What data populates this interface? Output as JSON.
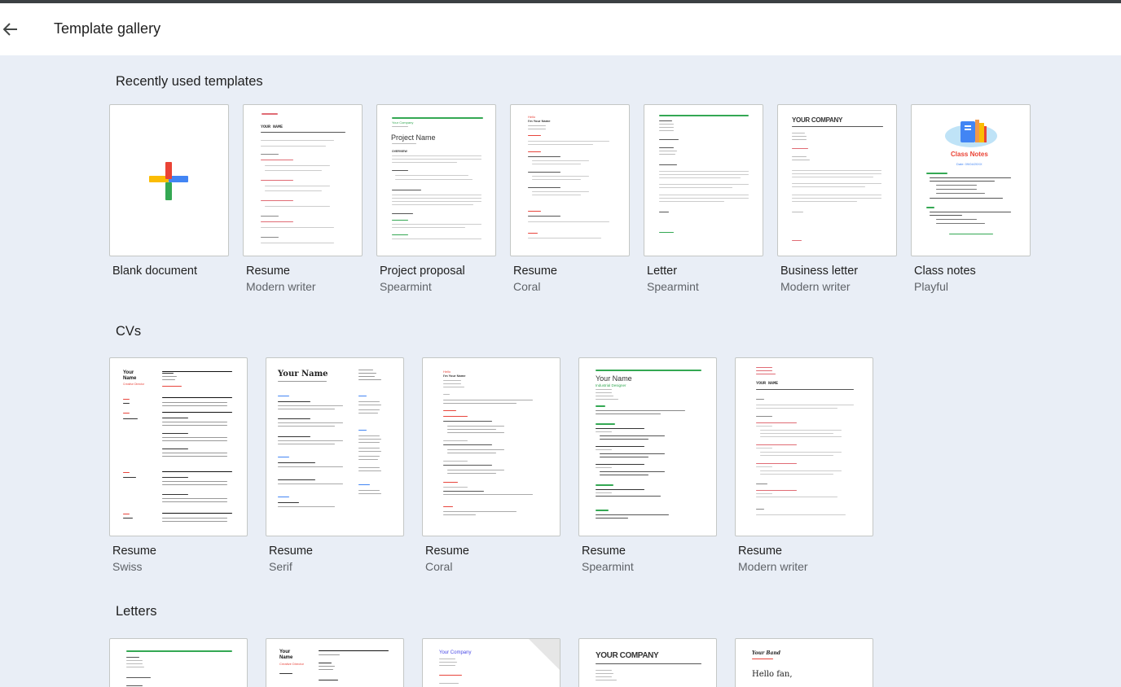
{
  "header": {
    "title": "Template gallery"
  },
  "sections": {
    "recent": "Recently used templates",
    "cvs": "CVs",
    "letters": "Letters"
  },
  "recent_templates": [
    {
      "name": "Blank document",
      "sub": ""
    },
    {
      "name": "Resume",
      "sub": "Modern writer"
    },
    {
      "name": "Project proposal",
      "sub": "Spearmint"
    },
    {
      "name": "Resume",
      "sub": "Coral"
    },
    {
      "name": "Letter",
      "sub": "Spearmint"
    },
    {
      "name": "Business letter",
      "sub": "Modern writer"
    },
    {
      "name": "Class notes",
      "sub": "Playful"
    }
  ],
  "cv_templates": [
    {
      "name": "Resume",
      "sub": "Swiss"
    },
    {
      "name": "Resume",
      "sub": "Serif"
    },
    {
      "name": "Resume",
      "sub": "Coral"
    },
    {
      "name": "Resume",
      "sub": "Spearmint"
    },
    {
      "name": "Resume",
      "sub": "Modern writer"
    }
  ],
  "thumb_text": {
    "modern_writer_name": "YOUR NAME",
    "proposal_company": "Your Company",
    "proposal_title": "Project Name",
    "proposal_overview": "OVERVIEW",
    "coral_hello": "Hello",
    "coral_name": "I'm Your Name",
    "business_company": "YOUR COMPANY",
    "classnotes_title": "Class Notes",
    "classnotes_date": "Date: 09/04/20XX",
    "swiss_name": "Your Name",
    "swiss_role": "Creative Director",
    "serif_name": "Your Name",
    "spearmint_name": "Your Name",
    "spearmint_role": "Industrial Designer",
    "mw_cv_name": "YOUR NAME",
    "letter_swiss_name": "Your Name",
    "letter_swiss_role": "Creative Director",
    "letter_company": "Your Company",
    "letter_your_company": "YOUR COMPANY",
    "letter_signature": "Your Band",
    "letter_hello": "Hello fan,"
  },
  "colors": {
    "accent_green": "#34a853",
    "accent_coral": "#e8453c",
    "plus_red": "#ea4335",
    "plus_blue": "#4285f4",
    "plus_yellow": "#fbbc04",
    "plus_green": "#34a853"
  }
}
